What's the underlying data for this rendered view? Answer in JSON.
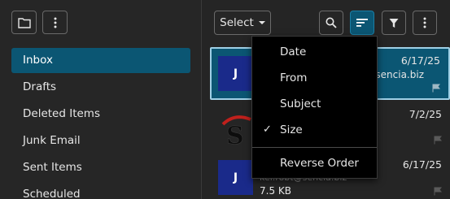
{
  "sidebar": {
    "folders": [
      {
        "label": "Inbox"
      },
      {
        "label": "Drafts"
      },
      {
        "label": "Deleted Items"
      },
      {
        "label": "Junk Email"
      },
      {
        "label": "Sent Items"
      },
      {
        "label": "Scheduled"
      }
    ],
    "active_index": 0
  },
  "toolbar": {
    "select_label": "Select"
  },
  "sort_menu": {
    "items": [
      {
        "label": "Date"
      },
      {
        "label": "From"
      },
      {
        "label": "Subject"
      },
      {
        "label": "Size",
        "checked": true
      }
    ],
    "reverse_label": "Reverse Order"
  },
  "messages": [
    {
      "avatar_initial": "J",
      "date": "6/17/25",
      "email_fragment": "@sencia.biz"
    },
    {
      "date": "7/2/25"
    },
    {
      "avatar_initial": "J",
      "date": "6/17/25",
      "email_fragment": "kei.robt@sencia.biz",
      "size": "7.5 KB"
    }
  ],
  "colors": {
    "accent": "#0b5673",
    "background": "#252525",
    "menu_background": "#000000"
  }
}
